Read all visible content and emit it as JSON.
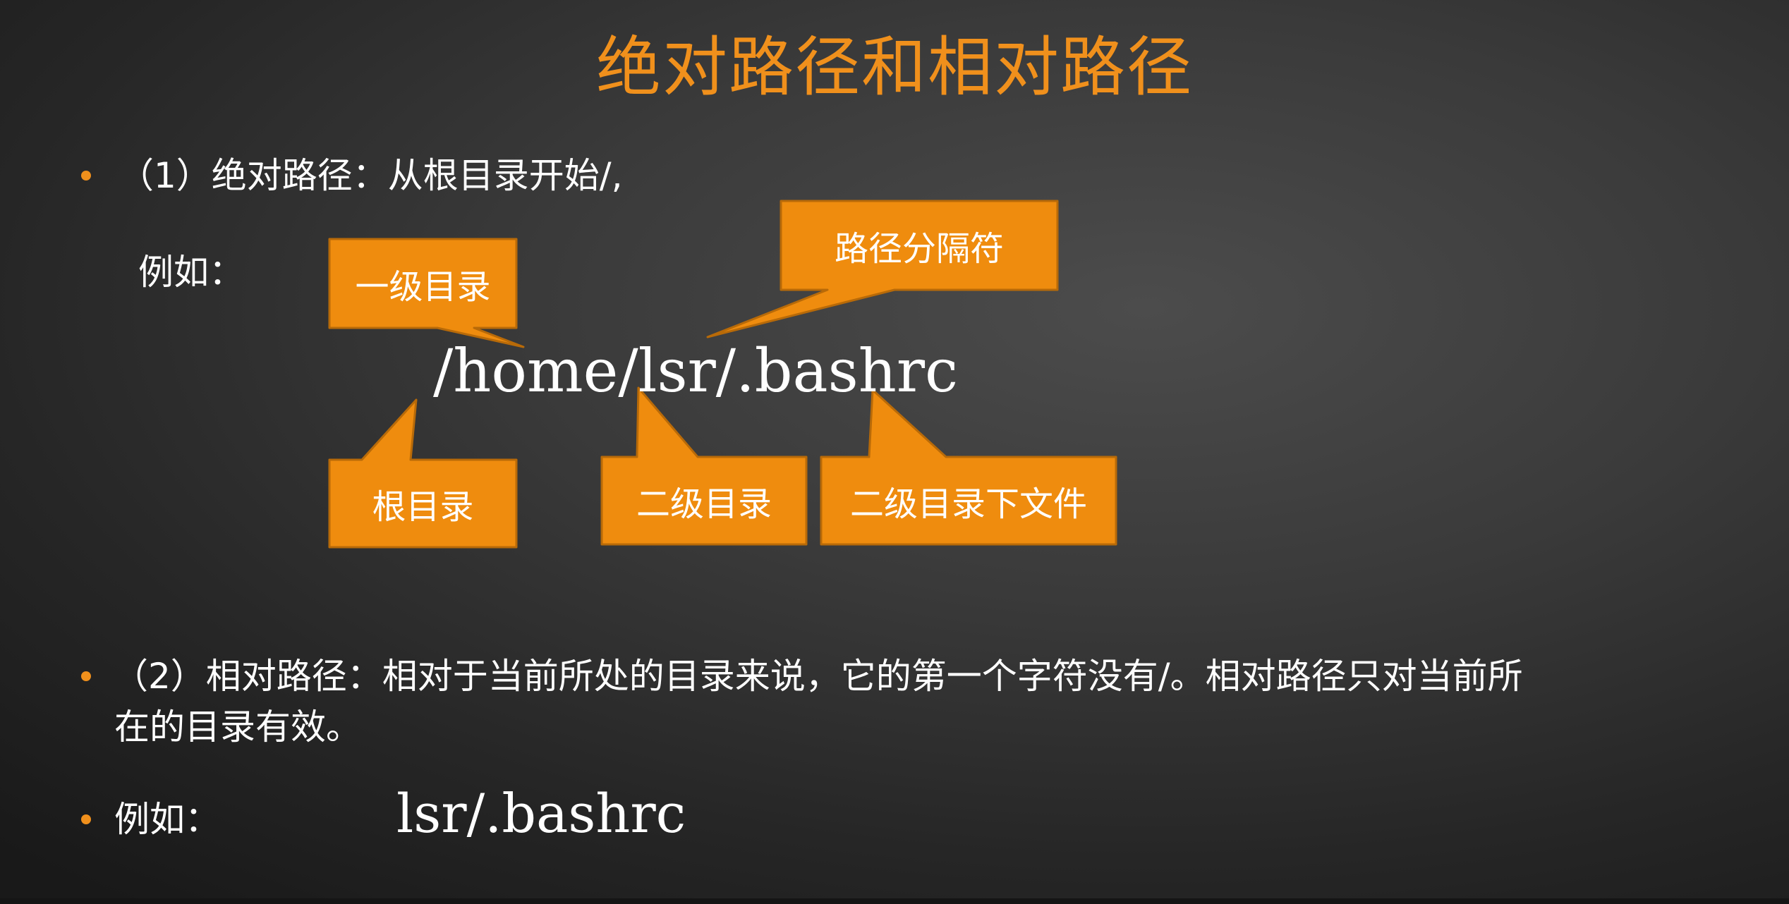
{
  "slide": {
    "title": "绝对路径和相对路径",
    "accent_color": "#f0901c",
    "background_color": "#3a3a3a"
  },
  "absolute": {
    "heading": "（1）绝对路径：从根目录开始/,",
    "example_label": "例如：",
    "path": "/home/lsr/.bashrc",
    "callouts": {
      "first_level": "一级目录",
      "separator": "路径分隔符",
      "root": "根目录",
      "second_level": "二级目录",
      "second_level_file": "二级目录下文件"
    }
  },
  "relative": {
    "heading_line1": "（2）相对路径：相对于当前所处的目录来说，它的第一个字符没有/。相对路径只对当前所",
    "heading_line2": "在的目录有效。",
    "example_label": "例如：",
    "path": "lsr/.bashrc"
  }
}
